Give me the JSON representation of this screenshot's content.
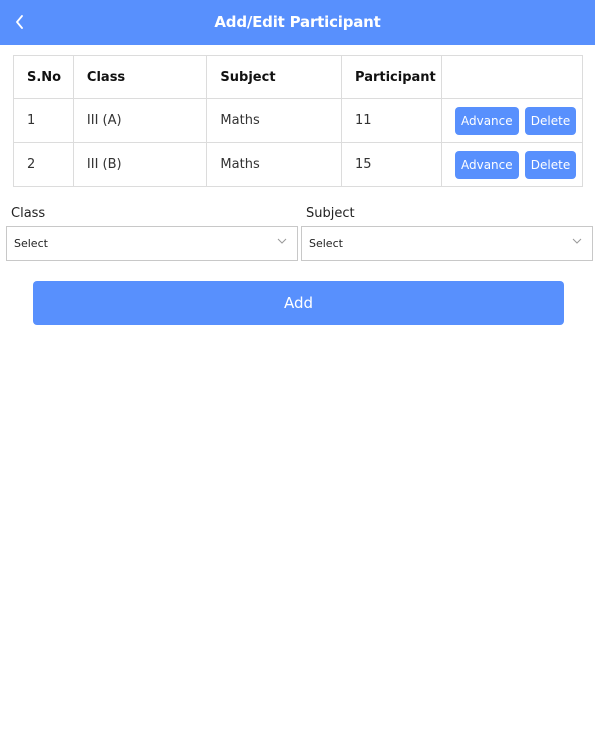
{
  "header": {
    "title": "Add/Edit Participant",
    "back_icon": "chevron-left-icon",
    "color": "#5890fd"
  },
  "table": {
    "columns": [
      "S.No",
      "Class",
      "Subject",
      "Participant",
      ""
    ],
    "rows": [
      {
        "sno": "1",
        "class": "III (A)",
        "subject": "Maths",
        "participant": "11",
        "advance_label": "Advance",
        "delete_label": "Delete"
      },
      {
        "sno": "2",
        "class": "III (B)",
        "subject": "Maths",
        "participant": "15",
        "advance_label": "Advance",
        "delete_label": "Delete"
      }
    ]
  },
  "form": {
    "class_label": "Class",
    "class_value": "Select",
    "subject_label": "Subject",
    "subject_value": "Select",
    "add_label": "Add"
  }
}
